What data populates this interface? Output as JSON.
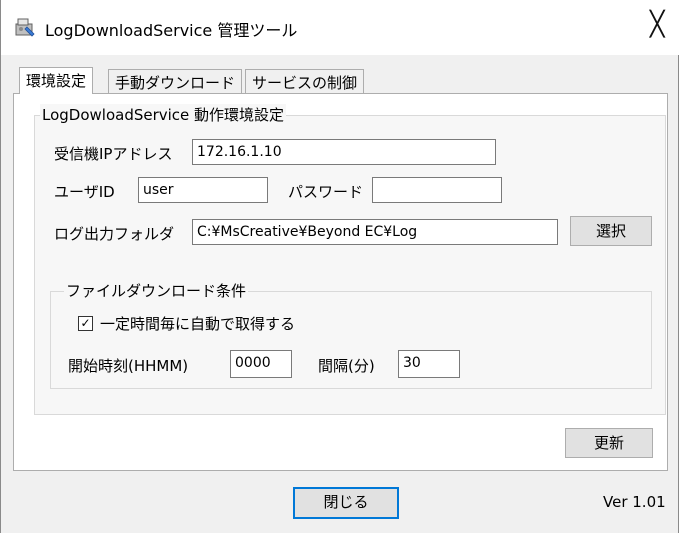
{
  "window": {
    "title": "LogDownloadService 管理ツール",
    "close_glyph": "╳"
  },
  "tabs": [
    {
      "label": "環境設定"
    },
    {
      "label": "手動ダウンロード"
    },
    {
      "label": "サービスの制御"
    }
  ],
  "settings": {
    "group_title": "LogDowloadService 動作環境設定",
    "ip_label": "受信機IPアドレス",
    "ip_value": "172.16.1.10",
    "user_label": "ユーザID",
    "user_value": "user",
    "password_label": "パスワード",
    "password_value": "",
    "folder_label": "ログ出力フォルダ",
    "folder_value": "C:¥MsCreative¥Beyond EC¥Log",
    "select_button": "選択"
  },
  "download_conditions": {
    "group_title": "ファイルダウンロード条件",
    "auto_checkbox_label": "一定時間毎に自動で取得する",
    "auto_checked": true,
    "check_glyph": "✓",
    "start_label": "開始時刻(HHMM)",
    "start_value": "0000",
    "interval_label": "間隔(分)",
    "interval_value": "30"
  },
  "buttons": {
    "update": "更新",
    "close": "閉じる"
  },
  "version": "Ver 1.01",
  "colors": {
    "accent": "#0078d7",
    "window_bg": "#f0f0f0"
  },
  "icons": {
    "app": "app-tool-icon",
    "close": "close-icon",
    "checkbox": "checkbox-checked-icon"
  }
}
